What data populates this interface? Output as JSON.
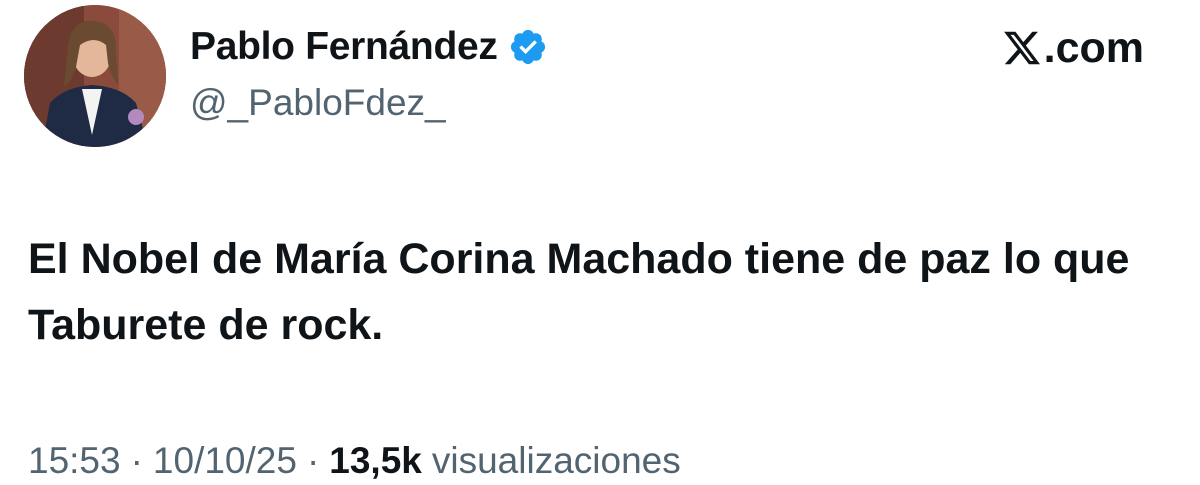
{
  "author": {
    "display_name": "Pablo Fernández",
    "handle": "@_PabloFdez_",
    "verified": true,
    "avatar_icon": "profile-photo"
  },
  "brand": {
    "label": ".com",
    "icon": "x-logo-icon"
  },
  "tweet": {
    "text": "El Nobel de María Corina Machado tiene de paz lo que Taburete de rock."
  },
  "meta": {
    "time": "15:53",
    "separator": "·",
    "date": "10/10/25",
    "views_count": "13,5k",
    "views_label": "visualizaciones"
  },
  "colors": {
    "verified_badge": "#1d9bf0",
    "secondary_text": "#536471",
    "primary_text": "#0f1419"
  }
}
